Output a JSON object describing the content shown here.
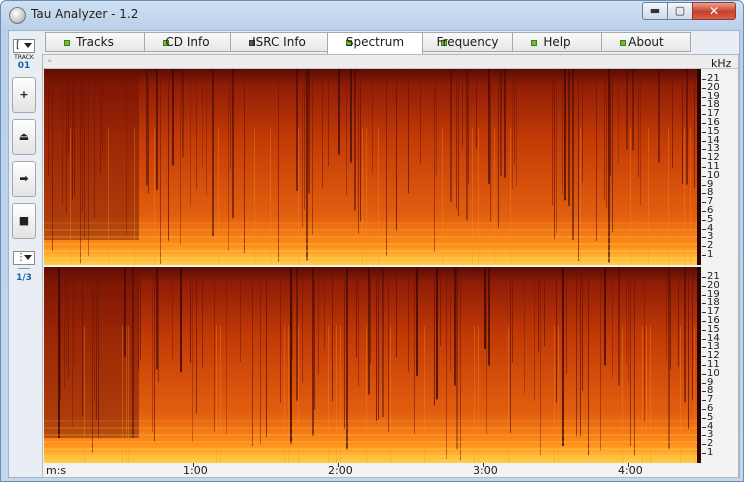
{
  "window": {
    "title": "Tau Analyzer - 1.2",
    "minimize": "▬",
    "maximize": "▢",
    "close": "✕"
  },
  "tabs": [
    {
      "label": "Tracks",
      "led": "green"
    },
    {
      "label": "CD Info",
      "led": "green"
    },
    {
      "label": "ISRC Info",
      "led": "dark"
    },
    {
      "label": "Spectrum",
      "led": "green",
      "active": true
    },
    {
      "label": "Frequency",
      "led": "green"
    },
    {
      "label": "Help",
      "led": "green"
    },
    {
      "label": "About",
      "led": "green"
    }
  ],
  "left_toolbar": {
    "track_dropdown_glyph": "[",
    "track_label": "TRACK",
    "track_number": "01",
    "buttons": [
      {
        "name": "zoom-in-button",
        "glyph": "+"
      },
      {
        "name": "eject-button",
        "glyph": "⏏"
      },
      {
        "name": "play-button",
        "glyph": "➡"
      },
      {
        "name": "stop-button",
        "glyph": "■"
      }
    ],
    "page_dropdown_glyph": "⋮",
    "page_small_label": "────",
    "page_number": "1/3"
  },
  "spectrum": {
    "unit_label": "kHz",
    "ruler_mark": "ᵤ",
    "x_axis_label": "m:s",
    "x_ticks": [
      "1:00",
      "2:00",
      "3:00",
      "4:00"
    ],
    "y_ticks": [
      "21",
      "20",
      "19",
      "18",
      "17",
      "16",
      "15",
      "14",
      "13",
      "12",
      "11",
      "10",
      "9",
      "8",
      "7",
      "6",
      "5",
      "4",
      "3",
      "2",
      "1"
    ],
    "colors": {
      "dark": "#5a0c05",
      "mid": "#c23a06",
      "bright": "#ff8c1a",
      "hot": "#ffd04a"
    }
  }
}
